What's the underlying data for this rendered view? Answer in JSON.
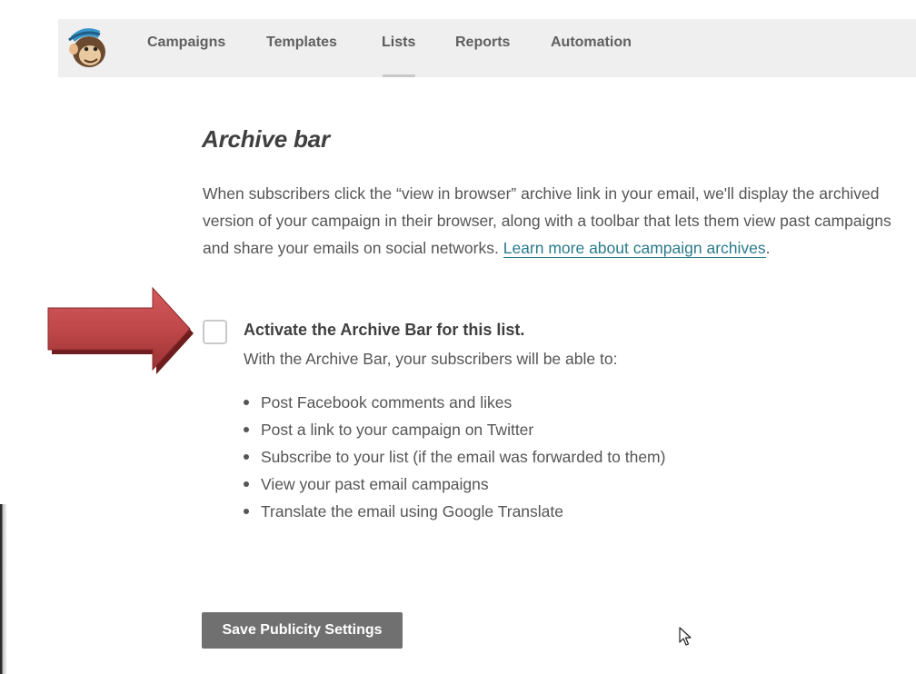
{
  "nav": {
    "items": [
      {
        "label": "Campaigns"
      },
      {
        "label": "Templates"
      },
      {
        "label": "Lists"
      },
      {
        "label": "Reports"
      },
      {
        "label": "Automation"
      }
    ],
    "active": "Lists"
  },
  "main": {
    "title": "Archive bar",
    "description": "When subscribers click the “view in browser” archive link in your email, we'll display the archived version of your campaign in their browser, along with a toolbar that lets them view past campaigns and share your emails on social networks. ",
    "learn_more_link": "Learn more about campaign archives",
    "description_end": ".",
    "checkbox": {
      "label": "Activate the Archive Bar for this list.",
      "checked": false,
      "subtext": "With the Archive Bar, your subscribers will be able to:"
    },
    "features": [
      "Post Facebook comments and likes",
      "Post a link to your campaign on Twitter",
      "Subscribe to your list (if the email was forwarded to them)",
      "View your past email campaigns",
      "Translate the email using Google Translate"
    ],
    "save_button": "Save Publicity Settings"
  },
  "colors": {
    "arrow": "#c0484a",
    "link": "#2a7a8c",
    "button": "#707070",
    "navbar": "#efefef"
  }
}
